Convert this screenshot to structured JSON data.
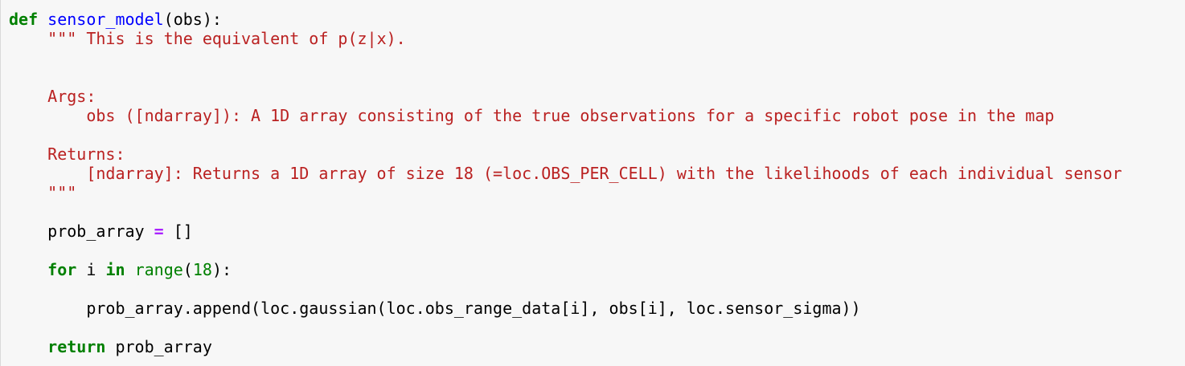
{
  "code": {
    "def_kw": "def",
    "func_name": "sensor_model",
    "signature_rest": "(obs):",
    "doc_open": "\"\"\" This is the equivalent of p(z|x).",
    "doc_args_header": "Args:",
    "doc_args_desc": "obs ([ndarray]): A 1D array consisting of the true observations for a specific robot pose in the map",
    "doc_returns_header": "Returns:",
    "doc_returns_desc": "[ndarray]: Returns a 1D array of size 18 (=loc.OBS_PER_CELL) with the likelihoods of each individual sensor",
    "doc_close": "\"\"\"",
    "assign_var": "prob_array",
    "assign_op": "=",
    "assign_val": "[]",
    "for_kw": "for",
    "loop_var": "i",
    "in_kw": "in",
    "range_fn": "range",
    "range_open": "(",
    "range_arg": "18",
    "range_close": "):",
    "append_stmt": "prob_array.append(loc.gaussian(loc.obs_range_data[i], obs[i], loc.sensor_sigma))",
    "return_kw": "return",
    "return_val": "prob_array"
  }
}
